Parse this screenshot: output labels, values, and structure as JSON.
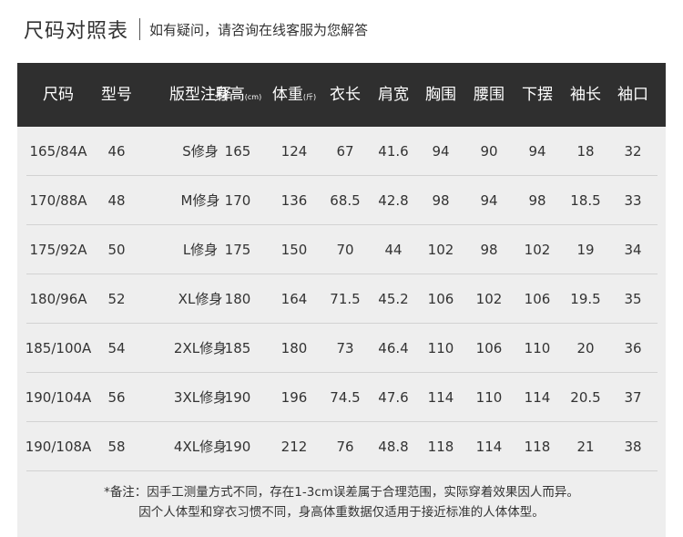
{
  "header": {
    "title": "尺码对照表",
    "subtitle": "如有疑问，请咨询在线客服为您解答"
  },
  "table": {
    "columns": [
      {
        "label": "尺码",
        "unit": ""
      },
      {
        "label": "型号",
        "unit": ""
      },
      {
        "label": "版型注释",
        "unit": ""
      },
      {
        "label": "身高",
        "unit": "(cm)"
      },
      {
        "label": "体重",
        "unit": "(斤)"
      },
      {
        "label": "衣长",
        "unit": ""
      },
      {
        "label": "肩宽",
        "unit": ""
      },
      {
        "label": "胸围",
        "unit": ""
      },
      {
        "label": "腰围",
        "unit": ""
      },
      {
        "label": "下摆",
        "unit": ""
      },
      {
        "label": "袖长",
        "unit": ""
      },
      {
        "label": "袖口",
        "unit": ""
      }
    ],
    "rows": [
      [
        "165/84A",
        "46",
        "S修身",
        "165",
        "124",
        "67",
        "41.6",
        "94",
        "90",
        "94",
        "18",
        "32"
      ],
      [
        "170/88A",
        "48",
        "M修身",
        "170",
        "136",
        "68.5",
        "42.8",
        "98",
        "94",
        "98",
        "18.5",
        "33"
      ],
      [
        "175/92A",
        "50",
        "L修身",
        "175",
        "150",
        "70",
        "44",
        "102",
        "98",
        "102",
        "19",
        "34"
      ],
      [
        "180/96A",
        "52",
        "XL修身",
        "180",
        "164",
        "71.5",
        "45.2",
        "106",
        "102",
        "106",
        "19.5",
        "35"
      ],
      [
        "185/100A",
        "54",
        "2XL修身",
        "185",
        "180",
        "73",
        "46.4",
        "110",
        "106",
        "110",
        "20",
        "36"
      ],
      [
        "190/104A",
        "56",
        "3XL修身",
        "190",
        "196",
        "74.5",
        "47.6",
        "114",
        "110",
        "114",
        "20.5",
        "37"
      ],
      [
        "190/108A",
        "58",
        "4XL修身",
        "190",
        "212",
        "76",
        "48.8",
        "118",
        "114",
        "118",
        "21",
        "38"
      ]
    ]
  },
  "notes": {
    "line1": "*备注：因手工测量方式不同，存在1-3cm误差属于合理范围，实际穿着效果因人而异。",
    "line2": "因个人体型和穿衣习惯不同，身高体重数据仅适用于接近标准的人体体型。"
  }
}
